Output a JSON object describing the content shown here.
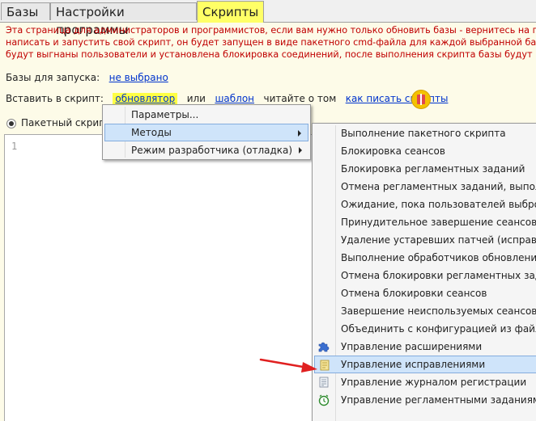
{
  "tabs": [
    "Базы",
    "Настройки программы",
    "Скрипты"
  ],
  "description_lines": [
    "Эта страница для администраторов и программистов, если вам нужно только обновить базы - вернитесь на пе",
    "написать и запустить свой скрипт, он будет запущен в виде пакетного cmd-файла для каждой выбранной ба",
    "будут выгнаны пользователи и установлена блокировка соединений, после выполнения скрипта базы будут"
  ],
  "bases": {
    "label": "Базы для запуска:",
    "value": "не выбрано"
  },
  "insert": {
    "label": "Вставить в скрипт:",
    "updater": "обновлятор",
    "or": "или",
    "template": "шаблон",
    "read_about": "читайте о том",
    "how_to": "как писать скрипты"
  },
  "radio_label": "Пакетный скрипт",
  "editor": {
    "line_number": "1"
  },
  "menu1": [
    {
      "label": "Параметры...",
      "submenu": false
    },
    {
      "label": "Методы",
      "submenu": true
    },
    {
      "label": "Режим разработчика (отладка)",
      "submenu": true
    }
  ],
  "menu2": [
    {
      "label": "Выполнение пакетного скрипта",
      "icon": ""
    },
    {
      "label": "Блокировка сеансов",
      "icon": ""
    },
    {
      "label": "Блокировка регламентных заданий",
      "icon": ""
    },
    {
      "label": "Отмена регламентных заданий, выполня",
      "icon": ""
    },
    {
      "label": "Ожидание, пока пользователей выброси",
      "icon": ""
    },
    {
      "label": "Принудительное завершение сеансов (кр",
      "icon": ""
    },
    {
      "label": "Удаление устаревших патчей (исправлен",
      "icon": ""
    },
    {
      "label": "Выполнение обработчиков обновления (",
      "icon": ""
    },
    {
      "label": "Отмена блокировки регламентных задан",
      "icon": ""
    },
    {
      "label": "Отмена блокировки сеансов",
      "icon": ""
    },
    {
      "label": "Завершение неиспользуемых сеансов",
      "icon": ""
    },
    {
      "label": "Объединить с конфигурацией из файла",
      "icon": ""
    },
    {
      "label": "Управление расширениями",
      "icon": "puzzle-icon"
    },
    {
      "label": "Управление исправлениями",
      "icon": "patch-icon"
    },
    {
      "label": "Управление журналом регистрации",
      "icon": "log-icon"
    },
    {
      "label": "Управление регламентными заданиями",
      "icon": "clock-icon"
    }
  ],
  "colors": {
    "active_tab": "#ffff66",
    "description": "#c00000",
    "link": "#0033cc",
    "menu_highlight": "#cfe4fa",
    "annotation_arrow": "#e02020"
  }
}
